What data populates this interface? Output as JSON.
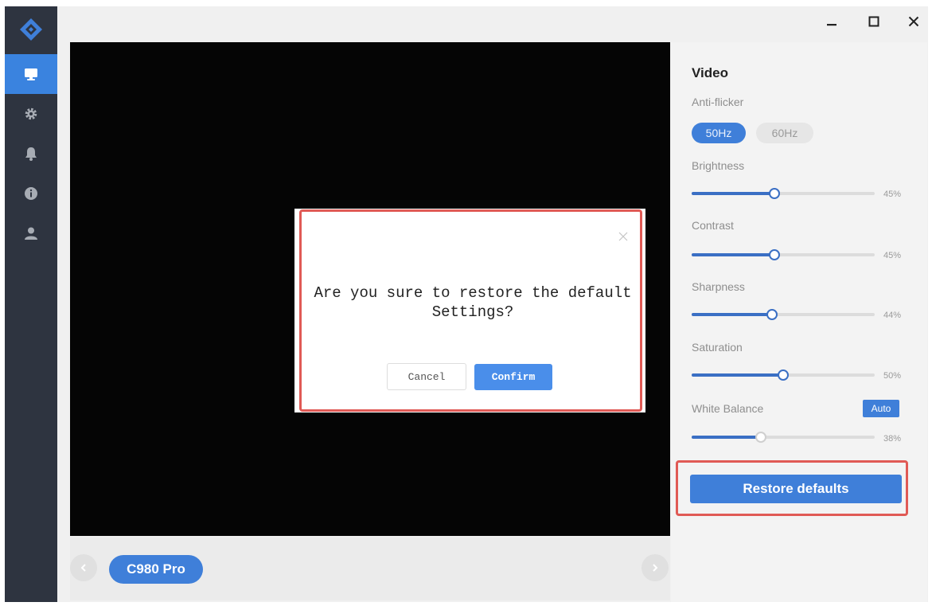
{
  "window_controls": {
    "minimize_icon": "minimize-icon",
    "maximize_icon": "maximize-icon",
    "close_icon": "close-icon"
  },
  "sidebar": {
    "logo_icon": "diamond-logo-icon",
    "items": [
      {
        "icon": "monitor-icon",
        "active": true
      },
      {
        "icon": "gear-icon",
        "active": false
      },
      {
        "icon": "bell-icon",
        "active": false
      },
      {
        "icon": "info-icon",
        "active": false
      },
      {
        "icon": "user-icon",
        "active": false
      }
    ]
  },
  "device_bar": {
    "device_name": "C980 Pro",
    "prev_icon": "chevron-left-icon",
    "next_icon": "chevron-right-icon"
  },
  "panel": {
    "section_title": "Video",
    "anti_flicker": {
      "label": "Anti-flicker",
      "options": [
        "50Hz",
        "60Hz"
      ],
      "selected": "50Hz"
    },
    "sliders": [
      {
        "label": "Brightness",
        "value": 45,
        "display": "45%"
      },
      {
        "label": "Contrast",
        "value": 45,
        "display": "45%"
      },
      {
        "label": "Sharpness",
        "value": 44,
        "display": "44%"
      },
      {
        "label": "Saturation",
        "value": 50,
        "display": "50%"
      },
      {
        "label": "White Balance",
        "value": 38,
        "display": "38%",
        "disabled": true
      }
    ],
    "white_balance_auto_label": "Auto",
    "restore_button_label": "Restore defaults"
  },
  "dialog": {
    "message_line1": "Are you sure to restore the default",
    "message_line2": "Settings?",
    "cancel_label": "Cancel",
    "confirm_label": "Confirm",
    "close_icon": "close-icon"
  },
  "colors": {
    "accent": "#3f7fd9",
    "sidebar_bg": "#2e3440",
    "highlight": "#e05a55",
    "video_bg": "#050505"
  }
}
